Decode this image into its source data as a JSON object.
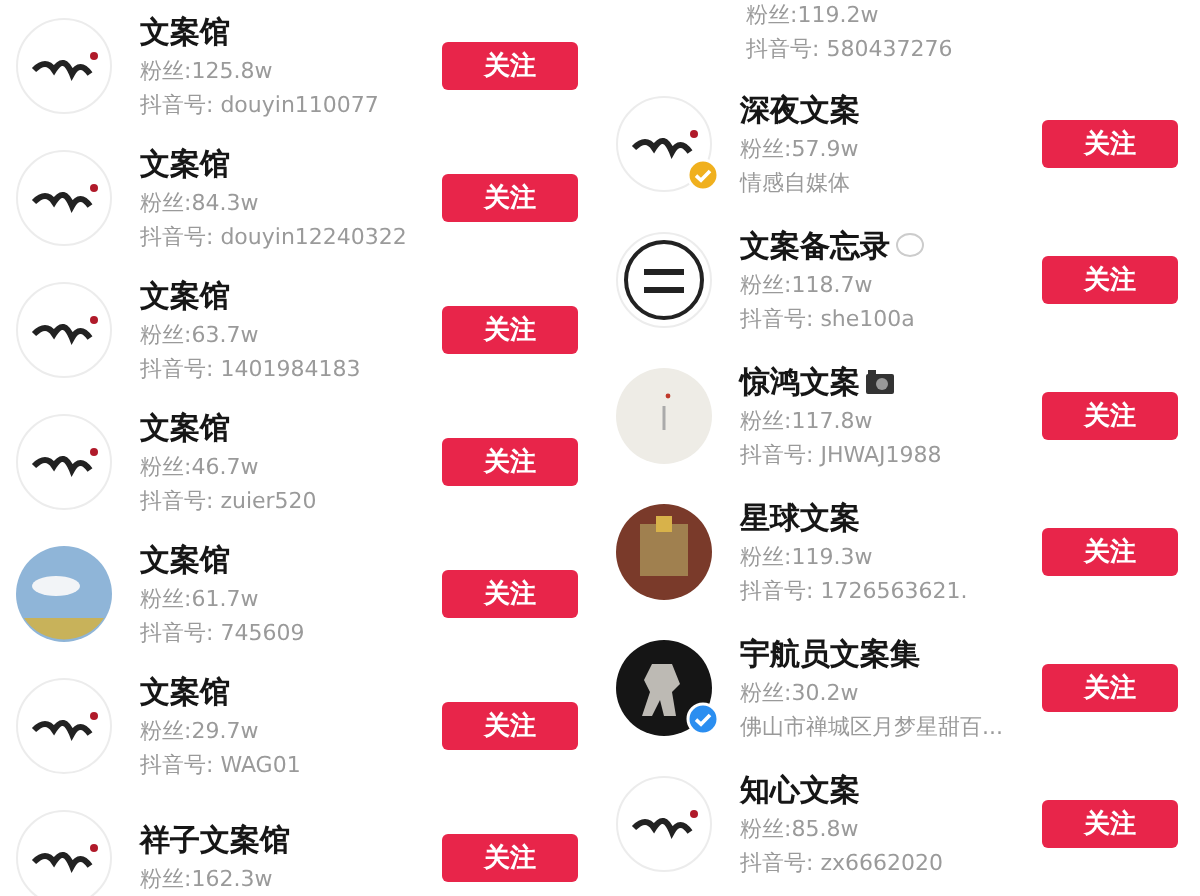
{
  "columns": [
    {
      "rows": [
        {
          "avatar": {
            "kind": "logo"
          },
          "name": "文案馆",
          "fans": "粉丝:125.8w",
          "id": "抖音号: douyin110077",
          "button": "关注"
        },
        {
          "avatar": {
            "kind": "logo"
          },
          "name": "文案馆",
          "fans": "粉丝:84.3w",
          "id": "抖音号: douyin12240322",
          "button": "关注"
        },
        {
          "avatar": {
            "kind": "logo"
          },
          "name": "文案馆",
          "fans": "粉丝:63.7w",
          "id": "抖音号: 1401984183",
          "button": "关注"
        },
        {
          "avatar": {
            "kind": "logo"
          },
          "name": "文案馆",
          "fans": "粉丝:46.7w",
          "id": "抖音号: zuier520",
          "button": "关注"
        },
        {
          "avatar": {
            "kind": "sky"
          },
          "name": "文案馆",
          "fans": "粉丝:61.7w",
          "id": "抖音号: 745609",
          "button": "关注"
        },
        {
          "avatar": {
            "kind": "logo"
          },
          "name": "文案馆",
          "fans": "粉丝:29.7w",
          "id": "抖音号: WAG01",
          "button": "关注"
        },
        {
          "avatar": {
            "kind": "logo"
          },
          "name": "祥子文案馆",
          "fans": "粉丝:162.3w",
          "button": "关注"
        }
      ]
    },
    {
      "cut_row": {
        "fans": "粉丝:119.2w",
        "id": "抖音号: 580437276"
      },
      "rows": [
        {
          "avatar": {
            "kind": "logo"
          },
          "badge": {
            "color": "#f0b01e"
          },
          "name": "深夜文案",
          "fans": "粉丝:57.9w",
          "id": "情感自媒体",
          "button": "关注"
        },
        {
          "avatar": {
            "kind": "seal"
          },
          "name": "文案备忘录",
          "name_icon": {
            "kind": "bubble"
          },
          "fans": "粉丝:118.7w",
          "id": "抖音号: she100a",
          "button": "关注"
        },
        {
          "avatar": {
            "kind": "plain"
          },
          "name": "惊鸿文案",
          "name_icon": {
            "kind": "camera"
          },
          "fans": "粉丝:117.8w",
          "id": "抖音号: JHWAJ1988",
          "button": "关注"
        },
        {
          "avatar": {
            "kind": "brown"
          },
          "name": "星球文案",
          "fans": "粉丝:119.3w",
          "id": "抖音号: 1726563621.",
          "button": "关注"
        },
        {
          "avatar": {
            "kind": "dark"
          },
          "badge": {
            "color": "#2b8ef0"
          },
          "name": "宇航员文案集",
          "fans": "粉丝:30.2w",
          "id": "佛山市禅城区月梦星甜百...",
          "button": "关注"
        },
        {
          "avatar": {
            "kind": "logo"
          },
          "name": "知心文案",
          "fans": "粉丝:85.8w",
          "id": "抖音号: zx6662020",
          "button": "关注"
        }
      ]
    }
  ]
}
